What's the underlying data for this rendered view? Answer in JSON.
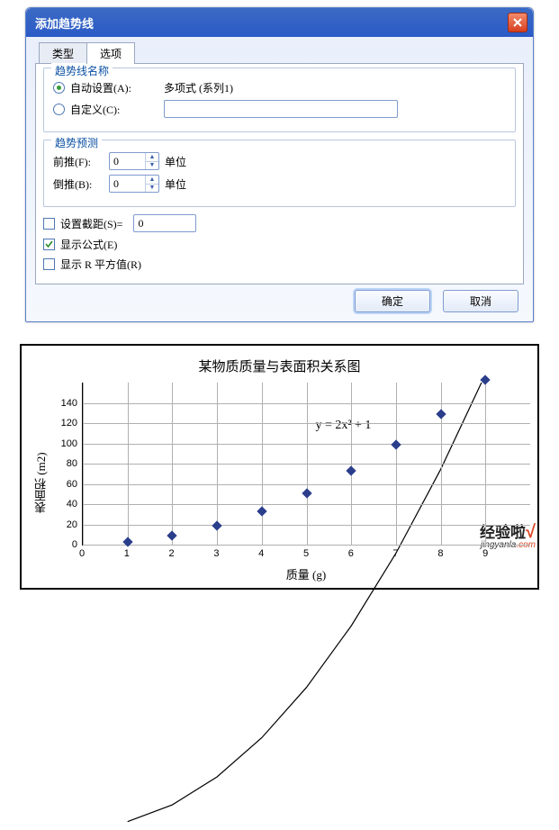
{
  "dialog": {
    "title": "添加趋势线",
    "tabs": {
      "type": "类型",
      "options": "选项"
    },
    "groups": {
      "name": {
        "title": "趋势线名称",
        "auto_label": "自动设置(A):",
        "auto_value": "多项式 (系列1)",
        "custom_label": "自定义(C):",
        "custom_value": ""
      },
      "forecast": {
        "title": "趋势预测",
        "forward_label": "前推(F):",
        "forward_value": "0",
        "forward_unit": "单位",
        "backward_label": "倒推(B):",
        "backward_value": "0",
        "backward_unit": "单位"
      },
      "opts": {
        "intercept_label": "设置截距(S)=",
        "intercept_value": "0",
        "show_eq_label": "显示公式(E)",
        "show_r2_label": "显示 R 平方值(R)"
      }
    },
    "buttons": {
      "ok": "确定",
      "cancel": "取消"
    }
  },
  "chart_data": {
    "type": "line",
    "title": "某物质质量与表面积关系图",
    "xlabel": "质量 (g)",
    "ylabel": "表面积 (m2)",
    "x": [
      1,
      2,
      3,
      4,
      5,
      6,
      7,
      8,
      9
    ],
    "y": [
      3,
      9,
      19,
      33,
      51,
      73,
      99,
      129,
      163
    ],
    "xlim": [
      0,
      10
    ],
    "ylim": [
      0,
      160
    ],
    "xticks": [
      0,
      1,
      2,
      3,
      4,
      5,
      6,
      7,
      8,
      9
    ],
    "yticks": [
      0,
      20,
      40,
      60,
      80,
      100,
      120,
      140
    ],
    "formula": "y = 2x² + 1",
    "grid": true,
    "marker": "diamond",
    "marker_color": "#2a3e8c",
    "line_color": "#000"
  },
  "watermark": {
    "line1": "经验啦",
    "check": "√",
    "line2_a": "jingyanla",
    "line2_b": ".com"
  }
}
